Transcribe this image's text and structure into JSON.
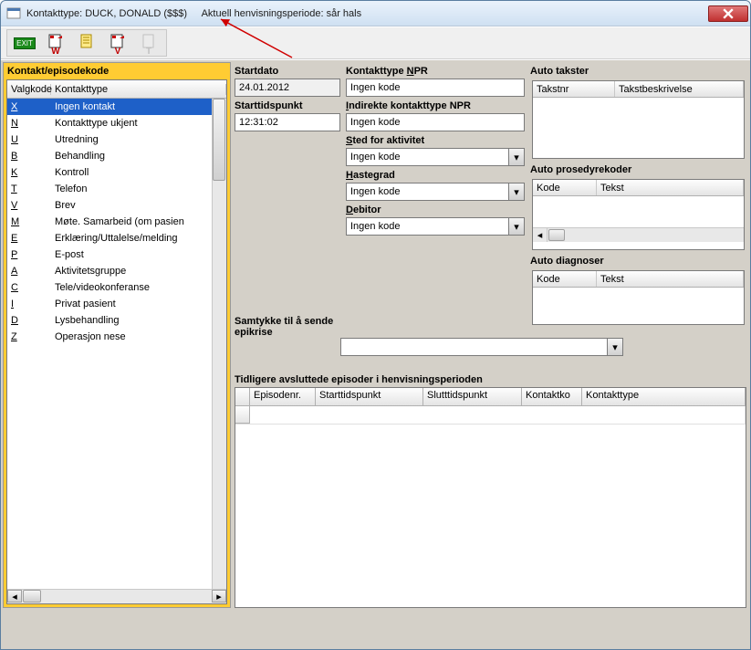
{
  "window": {
    "title_prefix": "Kontakttype:",
    "patient": "DUCK, DONALD ($$$)",
    "title_period_label": "Aktuell henvisningsperiode:",
    "title_period_value": "sår hals"
  },
  "toolbar": {
    "exit": "EXIT",
    "w": "W",
    "v": "V",
    "t": "T"
  },
  "left": {
    "panel_title": "Kontakt/episodekode",
    "col_valgkode": "Valgkode",
    "col_kontakttype": "Kontakttype",
    "items": [
      {
        "code": "X",
        "label": "Ingen kontakt",
        "selected": true
      },
      {
        "code": "N",
        "label": "Kontakttype ukjent"
      },
      {
        "code": "U",
        "label": "Utredning"
      },
      {
        "code": "B",
        "label": "Behandling"
      },
      {
        "code": "K",
        "label": "Kontroll"
      },
      {
        "code": "T",
        "label": "Telefon"
      },
      {
        "code": "V",
        "label": "Brev"
      },
      {
        "code": "M",
        "label": "Møte. Samarbeid (om pasien"
      },
      {
        "code": "E",
        "label": "Erklæring/Uttalelse/melding"
      },
      {
        "code": "P",
        "label": "E-post"
      },
      {
        "code": "A",
        "label": "Aktivitetsgruppe"
      },
      {
        "code": "C",
        "label": "Tele/videokonferanse"
      },
      {
        "code": "I",
        "label": "Privat pasient"
      },
      {
        "code": "D",
        "label": "Lysbehandling"
      },
      {
        "code": "Z",
        "label": "Operasjon nese"
      }
    ]
  },
  "form": {
    "startdato_label": "Startdato",
    "startdato_value": "24.01.2012",
    "starttid_label": "Starttidspunkt",
    "starttid_value": "12:31:02",
    "npr_label_pre": "Kontakttype ",
    "npr_label_u": "N",
    "npr_label_post": "PR",
    "npr_value": "Ingen kode",
    "ind_npr_label_u": "I",
    "ind_npr_label_post": "ndirekte kontakttype NPR",
    "ind_npr_value": "Ingen kode",
    "sted_label_u": "S",
    "sted_label_post": "ted for aktivitet",
    "sted_value": "Ingen kode",
    "haste_label_u": "H",
    "haste_label_post": "astegrad",
    "haste_value": "Ingen kode",
    "debitor_label_u": "D",
    "debitor_label_post": "ebitor",
    "debitor_value": "Ingen kode",
    "samtykke_label": "Samtykke til å sende epikrise",
    "samtykke_value": ""
  },
  "right": {
    "takster_title": "Auto takster",
    "takster_col1": "Takstnr",
    "takster_col2": "Takstbeskrivelse",
    "prosedyre_title": "Auto prosedyrekoder",
    "prosedyre_col1": "Kode",
    "prosedyre_col2": "Tekst",
    "diag_title": "Auto diagnoser",
    "diag_col1": "Kode",
    "diag_col2": "Tekst"
  },
  "episodes": {
    "title": "Tidligere avsluttede episoder i henvisningsperioden",
    "cols": [
      "",
      "Episodenr.",
      "Starttidspunkt",
      "Slutttidspunkt",
      "Kontaktko",
      "Kontakttype"
    ]
  }
}
